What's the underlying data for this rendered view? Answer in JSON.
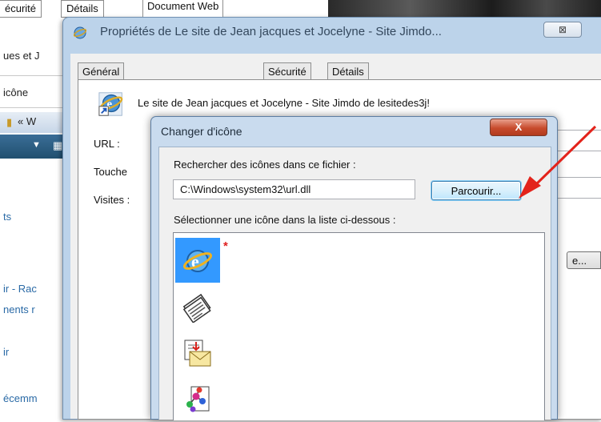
{
  "background": {
    "tabs": [
      "écurité",
      "Détails"
    ],
    "left_texts": [
      "ues et J",
      "icône",
      "« W",
      "ts",
      "ir - Rac",
      "nents r",
      "ir",
      "écemm"
    ]
  },
  "properties_dialog": {
    "title": "Propriétés de Le site de Jean jacques et Jocelyne - Site Jimdo...",
    "close_label": "⊠",
    "tabs": [
      {
        "label": "Général"
      },
      {
        "label": "Document Web"
      },
      {
        "label": "Sécurité"
      },
      {
        "label": "Détails"
      }
    ],
    "active_tab": "Document Web",
    "site_name": "Le site de Jean jacques et Jocelyne - Site Jimdo de lesitedes3j!",
    "fields": {
      "url_label": "URL :",
      "shortcut_label": "Touche",
      "visits_label": "Visites :"
    },
    "partial_button_label": "e..."
  },
  "change_icon_dialog": {
    "title": "Changer d'icône",
    "close_label": "X",
    "search_label": "Rechercher des icônes dans ce fichier :",
    "file_path": "C:\\Windows\\system32\\url.dll",
    "browse_label": "Parcourir...",
    "select_label": "Sélectionner une icône dans la liste ci-dessous :",
    "icons": [
      {
        "name": "internet-explorer-icon",
        "selected": true
      },
      {
        "name": "newspaper-icon",
        "selected": false
      },
      {
        "name": "mail-envelope-icon",
        "selected": false
      },
      {
        "name": "molecule-document-icon",
        "selected": false
      }
    ],
    "marker": "*"
  },
  "annotation": {
    "arrow_color": "#e3231b"
  }
}
